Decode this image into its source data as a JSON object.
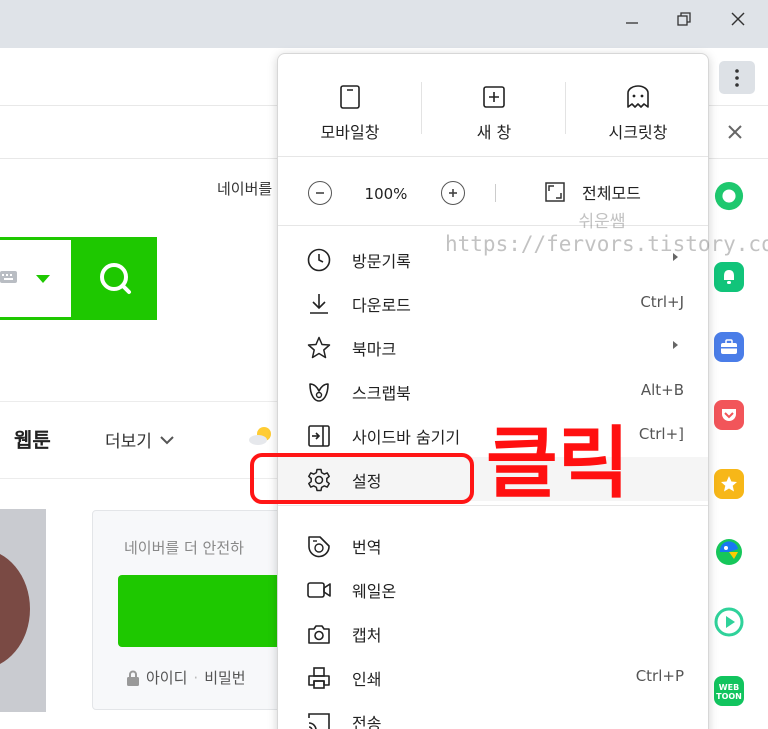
{
  "menu": {
    "top_buttons": [
      {
        "label": "모바일창",
        "icon": "mobile-icon"
      },
      {
        "label": "새 창",
        "icon": "new-window-icon"
      },
      {
        "label": "시크릿창",
        "icon": "secret-ghost-icon"
      }
    ],
    "zoom": {
      "minus_icon": "zoom-out-icon",
      "value": "100%",
      "plus_icon": "zoom-in-icon"
    },
    "fullscreen": {
      "label": "전체모드",
      "icon": "fullscreen-icon"
    },
    "items": [
      {
        "label": "방문기록",
        "shortcut": "",
        "submenu": true,
        "icon": "history-clock-icon"
      },
      {
        "label": "다운로드",
        "shortcut": "Ctrl+J",
        "submenu": false,
        "icon": "download-icon"
      },
      {
        "label": "북마크",
        "shortcut": "",
        "submenu": true,
        "icon": "star-icon"
      },
      {
        "label": "스크랩북",
        "shortcut": "Alt+B",
        "submenu": false,
        "icon": "scrapbook-icon"
      },
      {
        "label": "사이드바 숨기기",
        "shortcut": "Ctrl+]",
        "submenu": false,
        "icon": "sidebar-icon"
      },
      {
        "label": "설정",
        "shortcut": "",
        "submenu": false,
        "icon": "gear-icon"
      },
      {
        "label": "번역",
        "shortcut": "",
        "submenu": false,
        "icon": "translate-icon"
      },
      {
        "label": "웨일온",
        "shortcut": "",
        "submenu": false,
        "icon": "video-call-icon"
      },
      {
        "label": "캡처",
        "shortcut": "",
        "submenu": false,
        "icon": "camera-icon"
      },
      {
        "label": "인쇄",
        "shortcut": "Ctrl+P",
        "submenu": false,
        "icon": "print-icon"
      },
      {
        "label": "전송",
        "shortcut": "",
        "submenu": false,
        "icon": "cast-icon"
      }
    ]
  },
  "annotation": {
    "click_label": "클릭",
    "watermark_line1": "쉬운쌤",
    "watermark_line2": "https://fervors.tistory.com"
  },
  "page": {
    "top_link": "네이버를",
    "nav_webtoon": "웹툰",
    "nav_more": "더보기",
    "login_message": "네이버를 더 안전하",
    "login_id": "아이디",
    "login_pw": "비밀번"
  },
  "colors": {
    "naver_green": "#1ec800",
    "annotation_red": "#ff1515"
  }
}
